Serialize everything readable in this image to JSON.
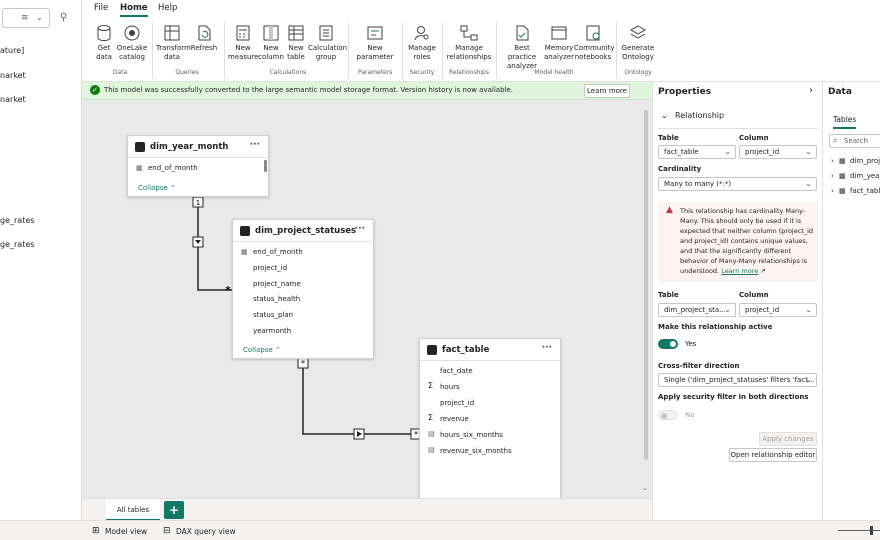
{
  "left_panel": {
    "items": [
      "ature]",
      "narket",
      "narket",
      "ge_rates",
      "ge_rates"
    ]
  },
  "ribbon": {
    "tabs": [
      "File",
      "Home",
      "Help"
    ],
    "active_tab": "Home",
    "buttons": {
      "get_data": "Get data",
      "onelake": "OneLake catalog",
      "transform": "Transform data",
      "refresh": "Refresh",
      "new_measure": "New measure",
      "new_column": "New column",
      "new_table": "New table",
      "calc_group": "Calculation group",
      "new_parameter": "New parameter",
      "manage_roles": "Manage roles",
      "manage_rel": "Manage relationships",
      "bpa": "Best practice analyzer",
      "mem": "Memory analyzer",
      "community": "Community notebooks",
      "gen_ontology": "Generate Ontology"
    },
    "groups": [
      "Data",
      "Queries",
      "Calculations",
      "Parameters",
      "Security",
      "Relationships",
      "Model health",
      "Ontology"
    ]
  },
  "infobar": {
    "message": "This model was successfully converted to the large semantic model storage format. Version history is now available.",
    "learn_more": "Learn more"
  },
  "tables": {
    "dim_year_month": {
      "title": "dim_year_month",
      "rows": [
        "end_of_month"
      ],
      "collapse": "Collapse"
    },
    "dim_project_statuses": {
      "title": "dim_project_statuses",
      "rows": [
        "end_of_month",
        "project_id",
        "project_name",
        "status_health",
        "status_plan",
        "yearmonth"
      ],
      "collapse": "Collapse"
    },
    "fact_table": {
      "title": "fact_table",
      "rows": [
        "fact_date",
        "hours",
        "project_id",
        "revenue",
        "hours_six_months",
        "revenue_six_months"
      ]
    }
  },
  "relationship_labels": {
    "one": "1",
    "many": "*"
  },
  "bottom": {
    "all_tables": "All tables",
    "add": "+"
  },
  "statusbar": {
    "model_view": "Model view",
    "dax_view": "DAX query view"
  },
  "properties": {
    "title": "Properties",
    "section": "Relationship",
    "table_label": "Table",
    "column_label": "Column",
    "table1": "fact_table",
    "column1": "project_id",
    "cardinality_label": "Cardinality",
    "cardinality": "Many to many (*:*)",
    "warning": "This relationship has cardinality Many-Many. This should only be used if it is expected that neither column (project_id and project_id) contains unique values, and that the significantly different behavior of Many-Many relationships is understood.",
    "warning_link": "Learn more",
    "table2": "dim_project_sta...",
    "column2": "project_id",
    "active_label": "Make this relationship active",
    "active_value": "Yes",
    "crossfilter_label": "Cross-filter direction",
    "crossfilter": "Single ('dim_project_statuses' filters 'fact...",
    "security_label": "Apply security filter in both directions",
    "security_value": "No",
    "apply_changes": "Apply changes",
    "open_editor": "Open relationship editor"
  },
  "data_pane": {
    "title": "Data",
    "tabs_label": "Tables",
    "search_placeholder": "Search",
    "tables": [
      "dim_proj",
      "dim_year",
      "fact_table"
    ]
  },
  "colors": {
    "accent": "#117865",
    "success_bg": "#dff6dd",
    "warning_icon": "#c4314b"
  }
}
